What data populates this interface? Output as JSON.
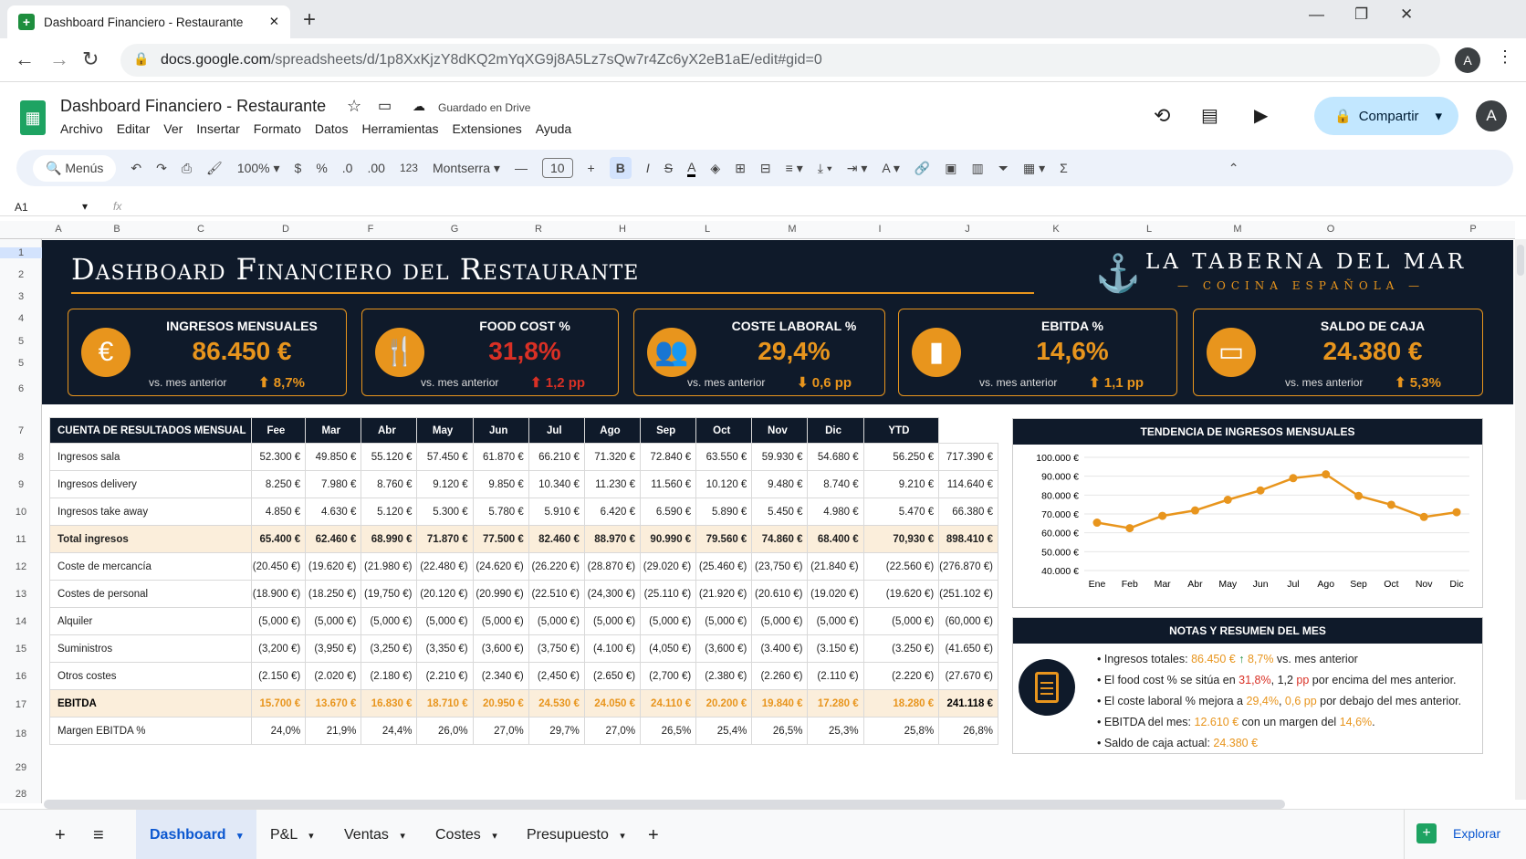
{
  "browser": {
    "tab_title": "Dashboard Financiero - Restaurante",
    "url_domain": "docs.google.com",
    "url_path": "/spreadsheets/d/1p8XxKjzY8dKQ2mYqXG9j8A5Lz7sQw7r4Zc6yX2eB1aE/edit#gid=0",
    "avatar": "A"
  },
  "doc": {
    "title": "Dashboard Financiero - Restaurante",
    "saved": "Guardado en Drive",
    "share": "Compartir",
    "avatar": "A"
  },
  "menu": [
    "Archivo",
    "Editar",
    "Ver",
    "Insertar",
    "Formato",
    "Datos",
    "Herramientas",
    "Extensiones",
    "Ayuda"
  ],
  "toolbar": {
    "search": "Menús",
    "zoom": "100%",
    "currency": "$",
    "percent": "%",
    "dec_less": ".0",
    "dec_more": ".00",
    "num": "123",
    "font": "Montserra",
    "size": "10",
    "bold": "B",
    "italic": "I",
    "strike": "S",
    "color": "A"
  },
  "formula": {
    "cell": "A1",
    "fx": "fx"
  },
  "columns": [
    "A",
    "B",
    "C",
    "D",
    "F",
    "G",
    "R",
    "H",
    "L",
    "M",
    "I",
    "J",
    "K",
    "L",
    "M",
    "O",
    "P"
  ],
  "rows": [
    "1",
    "2",
    "3",
    "4",
    "5",
    "5",
    "6",
    "7",
    "8",
    "9",
    "10",
    "11",
    "12",
    "13",
    "14",
    "15",
    "16",
    "17",
    "18",
    "29",
    "28"
  ],
  "dashboard": {
    "title": "Dashboard Financiero del Restaurante",
    "brand": "LA TABERNA DEL MAR",
    "brand_sub": "— COCINA ESPAÑOLA —"
  },
  "kpis": [
    {
      "label": "INGRESOS MENSUALES",
      "value": "86.450 €",
      "sub": "vs. mes anterior",
      "change": "8,7%",
      "dir": "up",
      "color": "#e8951d",
      "icon": "euro-icon",
      "glyph": "€"
    },
    {
      "label": "FOOD COST %",
      "value": "31,8%",
      "sub": "vs. mes anterior",
      "change": "1,2 pp",
      "dir": "up",
      "color": "#d93025",
      "icon": "cutlery-icon",
      "glyph": "🍴"
    },
    {
      "label": "COSTE LABORAL %",
      "value": "29,4%",
      "sub": "vs. mes anterior",
      "change": "0,6 pp",
      "dir": "down",
      "color": "#e8951d",
      "icon": "people-icon",
      "glyph": "👥"
    },
    {
      "label": "EBITDA %",
      "value": "14,6%",
      "sub": "vs. mes anterior",
      "change": "1,1 pp",
      "dir": "up",
      "color": "#e8951d",
      "icon": "bar-chart-icon",
      "glyph": "▮"
    },
    {
      "label": "SALDO DE CAJA",
      "value": "24.380 €",
      "sub": "vs. mes anterior",
      "change": "5,3%",
      "dir": "up",
      "color": "#e8951d",
      "icon": "wallet-icon",
      "glyph": "▭"
    }
  ],
  "pl": {
    "header": [
      "CUENTA DE RESULTADOS MENSUAL",
      "Fee",
      "Mar",
      "Abr",
      "May",
      "Jun",
      "Jul",
      "Ago",
      "Sep",
      "Oct",
      "Nov",
      "Dic",
      "YTD"
    ],
    "rows": [
      {
        "type": "n",
        "cells": [
          "Ingresos sala",
          "52.300 €",
          "49.850 €",
          "55.120 €",
          "57.450 €",
          "61.870 €",
          "66.210 €",
          "71.320 €",
          "72.840 €",
          "63.550 €",
          "59.930 €",
          "54.680 €",
          "56.250 €",
          "717.390 €"
        ]
      },
      {
        "type": "n",
        "cells": [
          "Ingresos delivery",
          "8.250 €",
          "7.980 €",
          "8.760 €",
          "9.120 €",
          "9.850 €",
          "10.340 €",
          "11.230 €",
          "11.560 €",
          "10.120 €",
          "9.480 €",
          "8.740 €",
          "9.210 €",
          "114.640 €"
        ]
      },
      {
        "type": "n",
        "cells": [
          "Ingresos take away",
          "4.850 €",
          "4.630 €",
          "5.120 €",
          "5.300 €",
          "5.780 €",
          "5.910 €",
          "6.420 €",
          "6.590 €",
          "5.890 €",
          "5.450 €",
          "4.980 €",
          "5.470 €",
          "66.380 €"
        ]
      },
      {
        "type": "tot",
        "cells": [
          "Total ingresos",
          "65.400 €",
          "62.460 €",
          "68.990 €",
          "71.870 €",
          "77.500 €",
          "82.460 €",
          "88.970 €",
          "90.990 €",
          "79.560 €",
          "74.860 €",
          "68.400 €",
          "70,930 €",
          "898.410 €"
        ]
      },
      {
        "type": "n",
        "cells": [
          "Coste de mercancía",
          "(20.450 €)",
          "(19.620 €)",
          "(21.980 €)",
          "(22.480 €)",
          "(24.620 €)",
          "(26.220 €)",
          "(28.870 €)",
          "(29.020 €)",
          "(25.460 €)",
          "(23,750 €)",
          "(21.840 €)",
          "(22.560 €)",
          "(276.870 €)"
        ]
      },
      {
        "type": "n",
        "cells": [
          "Costes de personal",
          "(18.900 €)",
          "(18.250 €)",
          "(19,750 €)",
          "(20.120 €)",
          "(20.990 €)",
          "(22.510 €)",
          "(24,300 €)",
          "(25.110 €)",
          "(21.920 €)",
          "(20.610 €)",
          "(19.020 €)",
          "(19.620 €)",
          "(251.102 €)"
        ]
      },
      {
        "type": "n",
        "cells": [
          "Alquiler",
          "(5,000 €)",
          "(5,000 €)",
          "(5,000 €)",
          "(5,000 €)",
          "(5,000 €)",
          "(5,000 €)",
          "(5,000 €)",
          "(5,000 €)",
          "(5,000 €)",
          "(5,000 €)",
          "(5,000 €)",
          "(5,000 €)",
          "(60,000 €)"
        ]
      },
      {
        "type": "n",
        "cells": [
          "Suministros",
          "(3,200 €)",
          "(3,950 €)",
          "(3,250 €)",
          "(3,350 €)",
          "(3,600 €)",
          "(3,750 €)",
          "(4.100 €)",
          "(4,050 €)",
          "(3,600 €)",
          "(3.400 €)",
          "(3.150 €)",
          "(3.250 €)",
          "(41.650 €)"
        ]
      },
      {
        "type": "n",
        "cells": [
          "Otros costes",
          "(2.150 €)",
          "(2.020 €)",
          "(2.180 €)",
          "(2.210 €)",
          "(2.340 €)",
          "(2,450 €)",
          "(2.650 €)",
          "(2,700 €)",
          "(2.380 €)",
          "(2.260 €)",
          "(2.110 €)",
          "(2.220 €)",
          "(27.670 €)"
        ]
      },
      {
        "type": "ebit",
        "cells": [
          "EBITDA",
          "15.700 €",
          "13.670 €",
          "16.830 €",
          "18.710 €",
          "20.950 €",
          "24.530 €",
          "24.050 €",
          "24.110 €",
          "20.200 €",
          "19.840 €",
          "17.280 €",
          "18.280 €",
          "241.118 €"
        ]
      },
      {
        "type": "n",
        "cells": [
          "Margen EBITDA %",
          "24,0%",
          "21,9%",
          "24,4%",
          "26,0%",
          "27,0%",
          "29,7%",
          "27,0%",
          "26,5%",
          "25,4%",
          "26,5%",
          "25,3%",
          "25,8%",
          "26,8%"
        ]
      }
    ]
  },
  "chart_data": {
    "type": "line",
    "title": "TENDENCIA DE INGRESOS MENSUALES",
    "categories": [
      "Ene",
      "Feb",
      "Mar",
      "Abr",
      "May",
      "Jun",
      "Jul",
      "Ago",
      "Sep",
      "Oct",
      "Nov",
      "Dic"
    ],
    "values": [
      65400,
      62460,
      68990,
      71870,
      77500,
      82460,
      88970,
      90990,
      79560,
      74860,
      68400,
      70930
    ],
    "ylim": [
      40000,
      100000
    ],
    "yticks": [
      "100.000 €",
      "90.000 €",
      "80.000 €",
      "70.000 €",
      "60.000 €",
      "50.000 €",
      "40.000 €"
    ],
    "color": "#e8951d",
    "grid": true
  },
  "notes": {
    "title": "NOTAS Y RESUMEN DEL MES",
    "items": [
      {
        "pre": "Ingresos totales: ",
        "v1": "86.450 €",
        "mid": " ↑ ",
        "v2": "8,7%",
        "post": " vs. mes anterior"
      },
      {
        "pre": "El food cost % se sitúa en ",
        "v1": "31,8%",
        "mid": ", 1,2 ",
        "v2": "pp",
        "post": " por encima del mes anterior."
      },
      {
        "pre": "El coste laboral % mejora a ",
        "v1": "29,4%",
        "mid": ", ",
        "v2": "0,6 pp",
        "post": " por debajo del mes anterior."
      },
      {
        "pre": "EBITDA del mes: ",
        "v1": "12.610 €",
        "mid": " con un margen del ",
        "v2": "14,6%",
        "post": "."
      },
      {
        "pre": "Saldo de caja actual: ",
        "v1": "24.380 €",
        "mid": "",
        "v2": "",
        "post": ""
      }
    ]
  },
  "sheets": [
    "Dashboard",
    "P&L",
    "Ventas",
    "Costes",
    "Presupuesto"
  ],
  "explore": "Explorar"
}
